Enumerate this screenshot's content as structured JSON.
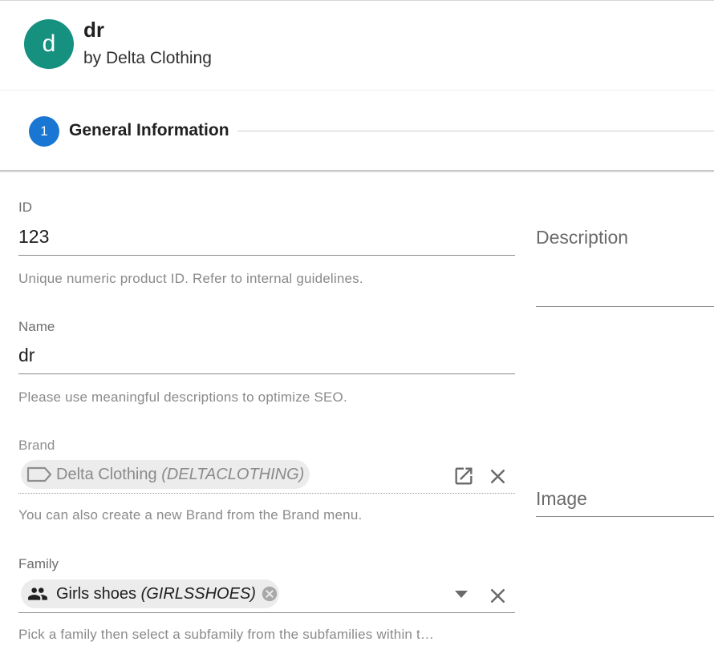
{
  "header": {
    "avatar_letter": "d",
    "title": "dr",
    "subtitle": "by Delta Clothing"
  },
  "stepper": {
    "step_number": "1",
    "step_label": "General Information"
  },
  "fields": {
    "id": {
      "label": "ID",
      "value": "123",
      "hint": "Unique numeric product ID. Refer to internal guidelines."
    },
    "name": {
      "label": "Name",
      "value": "dr",
      "hint": "Please use meaningful descriptions to optimize SEO."
    },
    "brand": {
      "label": "Brand",
      "chip_name": "Delta Clothing",
      "chip_code": "(DELTACLOTHING)",
      "hint": "You can also create a new Brand from the Brand menu.",
      "chip_icon": "label-tag-icon",
      "open_icon": "open-in-new-icon",
      "clear_icon": "close-icon"
    },
    "family": {
      "label": "Family",
      "chip_name": "Girls shoes",
      "chip_code": "(GIRLSSHOES)",
      "hint": "Pick a family then select a subfamily from the subfamilies within t…",
      "chip_icon": "people-icon",
      "chip_remove_icon": "cancel-circle-icon",
      "dropdown_icon": "caret-down-icon",
      "clear_icon": "close-icon"
    },
    "description": {
      "label": "Description"
    },
    "image": {
      "label": "Image"
    }
  },
  "colors": {
    "avatar": "#16907f",
    "step_active": "#1976d2"
  }
}
